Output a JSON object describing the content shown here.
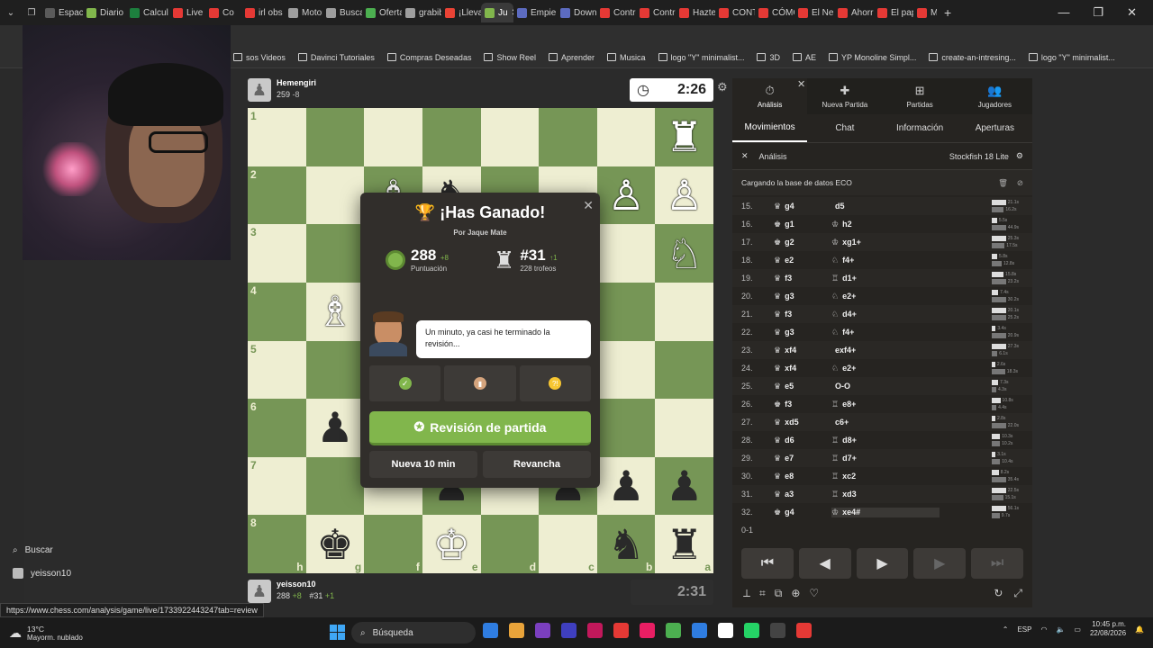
{
  "browser": {
    "tabs": [
      {
        "label": "Espaci",
        "color": "#5a5a5a"
      },
      {
        "label": "Diario",
        "color": "#81b64c"
      },
      {
        "label": "Calcul",
        "color": "#1d7f3e"
      },
      {
        "label": "Live Te",
        "color": "#e53935"
      },
      {
        "label": "Co",
        "color": "#e53935"
      },
      {
        "label": "irl obs",
        "color": "#e53935"
      },
      {
        "label": "Motor",
        "color": "#9e9e9e"
      },
      {
        "label": "Buscar",
        "color": "#9e9e9e"
      },
      {
        "label": "Oferta",
        "color": "#4caf50"
      },
      {
        "label": "grabib",
        "color": "#9e9e9e"
      },
      {
        "label": "¡Llevas",
        "color": "#ea4335"
      },
      {
        "label": "Ju",
        "color": "#81b64c"
      },
      {
        "label": "Empie",
        "color": "#5c6bc0"
      },
      {
        "label": "Downl",
        "color": "#5c6bc0"
      },
      {
        "label": "Contro",
        "color": "#e53935"
      },
      {
        "label": "Contro",
        "color": "#e53935"
      },
      {
        "label": "Hazte",
        "color": "#e53935"
      },
      {
        "label": "CONTI",
        "color": "#e53935"
      },
      {
        "label": "CÓMC",
        "color": "#e53935"
      },
      {
        "label": "El Ner",
        "color": "#e53935"
      },
      {
        "label": "Ahorr",
        "color": "#e53935"
      },
      {
        "label": "El pap",
        "color": "#e53935"
      },
      {
        "label": "M",
        "color": "#e53935"
      }
    ],
    "new_tab": "+",
    "win_min": "—",
    "win_max": "❐",
    "win_close": "✕",
    "bookmarks": [
      "sos Videos",
      "Davinci Tutoriales",
      "Compras Deseadas",
      "Show Reel",
      "Aprender",
      "Musica",
      "logo \"Y\" minimalist...",
      "3D",
      "AE",
      "YP Monoline Simpl...",
      "create-an-intresing...",
      "logo \"Y\" minimalist..."
    ],
    "status_url": "https://www.chess.com/analysis/game/live/1733922443247tab=review"
  },
  "left": {
    "search_label": "Buscar",
    "user_label": "yeisson10"
  },
  "top_player": {
    "name": "Hemengiri",
    "rating": "259",
    "rating_delta": "-8",
    "clock": "2:26"
  },
  "bottom_player": {
    "name": "yeisson10",
    "rating": "288",
    "rating_delta": "+8",
    "rank": "#31",
    "rank_delta": "+1",
    "clock": "2:31"
  },
  "board": {
    "light": "#eeeed2",
    "dark": "#769656",
    "ranks": [
      "1",
      "2",
      "3",
      "4",
      "5",
      "6",
      "7",
      "8"
    ],
    "files": [
      "h",
      "g",
      "f",
      "e",
      "d",
      "c",
      "b",
      "a"
    ],
    "rows": [
      [
        "",
        "",
        "",
        "",
        "",
        "",
        "",
        "♜"
      ],
      [
        "",
        "",
        "♗",
        "♞",
        "",
        "",
        "♙",
        "♙"
      ],
      [
        "",
        "",
        "",
        "",
        "",
        "",
        "",
        "♘"
      ],
      [
        "",
        "♗",
        "",
        "",
        "",
        "",
        "",
        ""
      ],
      [
        "",
        "",
        "",
        "",
        "",
        "",
        "",
        ""
      ],
      [
        "",
        "♟",
        "",
        "",
        "",
        "",
        "",
        ""
      ],
      [
        "",
        "",
        "",
        "♟",
        "",
        "♟",
        "♟",
        "♟"
      ],
      [
        "",
        "♚",
        "",
        "♔",
        "",
        "",
        "♞",
        "♜"
      ]
    ],
    "white_rows": [
      [
        0,
        0,
        0,
        0,
        0,
        0,
        0,
        1
      ],
      [
        0,
        0,
        1,
        0,
        0,
        0,
        1,
        1
      ],
      [
        0,
        0,
        0,
        0,
        0,
        0,
        0,
        1
      ],
      [
        0,
        1,
        0,
        0,
        0,
        0,
        0,
        0
      ],
      [
        0,
        0,
        0,
        0,
        0,
        0,
        0,
        0
      ],
      [
        0,
        0,
        0,
        0,
        0,
        0,
        0,
        0
      ],
      [
        0,
        0,
        0,
        0,
        0,
        0,
        0,
        0
      ],
      [
        0,
        0,
        0,
        1,
        0,
        0,
        0,
        0
      ]
    ]
  },
  "modal": {
    "title": "¡Has Ganado!",
    "subtitle": "Por Jaque Mate",
    "score_value": "288",
    "score_delta": "+8",
    "score_label": "Puntuación",
    "rank_value": "#31",
    "rank_delta": "↑1",
    "rank_label": "228 trofeos",
    "bubble_text": "Un minuto, ya casi he terminado la revisión...",
    "review_button": "Revisión de partida",
    "new_game_button": "Nueva 10 min",
    "rematch_button": "Revancha"
  },
  "panel": {
    "tabs": [
      {
        "label": "Análisis",
        "icon": "⏱"
      },
      {
        "label": "Nueva Partida",
        "icon": "✚"
      },
      {
        "label": "Partidas",
        "icon": "⊞"
      },
      {
        "label": "Jugadores",
        "icon": "👥"
      }
    ],
    "close": "✕",
    "subtabs": [
      "Movimientos",
      "Chat",
      "Información",
      "Aperturas"
    ],
    "analysis_label": "Análisis",
    "engine_label": "Stockfish 18 Lite",
    "eco_label": "Cargando la base de datos ECO",
    "moves": [
      {
        "n": "15.",
        "w": "g4",
        "b": "d5",
        "wp": "♛",
        "bp": ""
      },
      {
        "n": "16.",
        "w": "g1",
        "b": "h2",
        "wp": "♚",
        "bp": "♔"
      },
      {
        "n": "17.",
        "w": "g2",
        "b": "xg1+",
        "wp": "♚",
        "bp": "♔"
      },
      {
        "n": "18.",
        "w": "e2",
        "b": "f4+",
        "wp": "♛",
        "bp": "♘"
      },
      {
        "n": "19.",
        "w": "f3",
        "b": "d1+",
        "wp": "♛",
        "bp": "♖"
      },
      {
        "n": "20.",
        "w": "g3",
        "b": "e2+",
        "wp": "♛",
        "bp": "♘"
      },
      {
        "n": "21.",
        "w": "f3",
        "b": "d4+",
        "wp": "♛",
        "bp": "♘"
      },
      {
        "n": "22.",
        "w": "g3",
        "b": "f4+",
        "wp": "♛",
        "bp": "♘"
      },
      {
        "n": "23.",
        "w": "xf4",
        "b": "exf4+",
        "wp": "♛",
        "bp": ""
      },
      {
        "n": "24.",
        "w": "xf4",
        "b": "e2+",
        "wp": "♛",
        "bp": "♘"
      },
      {
        "n": "25.",
        "w": "e5",
        "b": "O-O",
        "wp": "♛",
        "bp": ""
      },
      {
        "n": "26.",
        "w": "f3",
        "b": "e8+",
        "wp": "♚",
        "bp": "♖"
      },
      {
        "n": "27.",
        "w": "xd5",
        "b": "c6+",
        "wp": "♛",
        "bp": ""
      },
      {
        "n": "28.",
        "w": "d6",
        "b": "d8+",
        "wp": "♛",
        "bp": "♖"
      },
      {
        "n": "29.",
        "w": "e7",
        "b": "d7+",
        "wp": "♛",
        "bp": "♖"
      },
      {
        "n": "30.",
        "w": "e8",
        "b": "xc2",
        "wp": "♛",
        "bp": "♖"
      },
      {
        "n": "31.",
        "w": "a3",
        "b": "xd3",
        "wp": "♛",
        "bp": "♖"
      },
      {
        "n": "32.",
        "w": "g4",
        "b": "xe4#",
        "wp": "♚",
        "bp": "♔"
      }
    ],
    "times": [
      [
        "21.1s",
        "16.2s"
      ],
      [
        "5.5s",
        "44.9s"
      ],
      [
        "25.3s",
        "17.5s"
      ],
      [
        "5.8s",
        "12.8s"
      ],
      [
        "15.8s",
        "23.2s"
      ],
      [
        "7.4s",
        "30.2s"
      ],
      [
        "20.1s",
        "25.2s"
      ],
      [
        "3.4s",
        "20.9s"
      ],
      [
        "27.3s",
        "6.1s"
      ],
      [
        "2.6s",
        "18.3s"
      ],
      [
        "7.3s",
        "4.3s"
      ],
      [
        "10.8s",
        "4.4s"
      ],
      [
        "2.8s",
        "22.0s"
      ],
      [
        "10.3s",
        "10.2s"
      ],
      [
        "3.1s",
        "10.4s"
      ],
      [
        "8.2s",
        "35.4s"
      ],
      [
        "22.5s",
        "15.1s"
      ],
      [
        "56.1s",
        "9.7s"
      ]
    ],
    "result": "0-1",
    "nav": [
      "⏮",
      "◀",
      "▶",
      "▶",
      "⏭"
    ],
    "tools": [
      "⟂",
      "⌗",
      "⧉",
      "⊕",
      "♡"
    ],
    "tools_right": [
      "↻",
      "⤢"
    ]
  },
  "taskbar": {
    "temp": "13°C",
    "weather": "Mayorm. nublado",
    "search": "Búsqueda",
    "time": "10:45 p.m.",
    "date": "22/08/2026",
    "lang": "ESP",
    "app_colors": [
      "#2f7de1",
      "#e8a33a",
      "#7b3fbf",
      "#3f3fbf",
      "#c2185b",
      "#e53935",
      "#e91e63",
      "#4caf50",
      "#2f7de1",
      "#fff",
      "#25d366",
      "#444",
      "#e53935"
    ]
  }
}
